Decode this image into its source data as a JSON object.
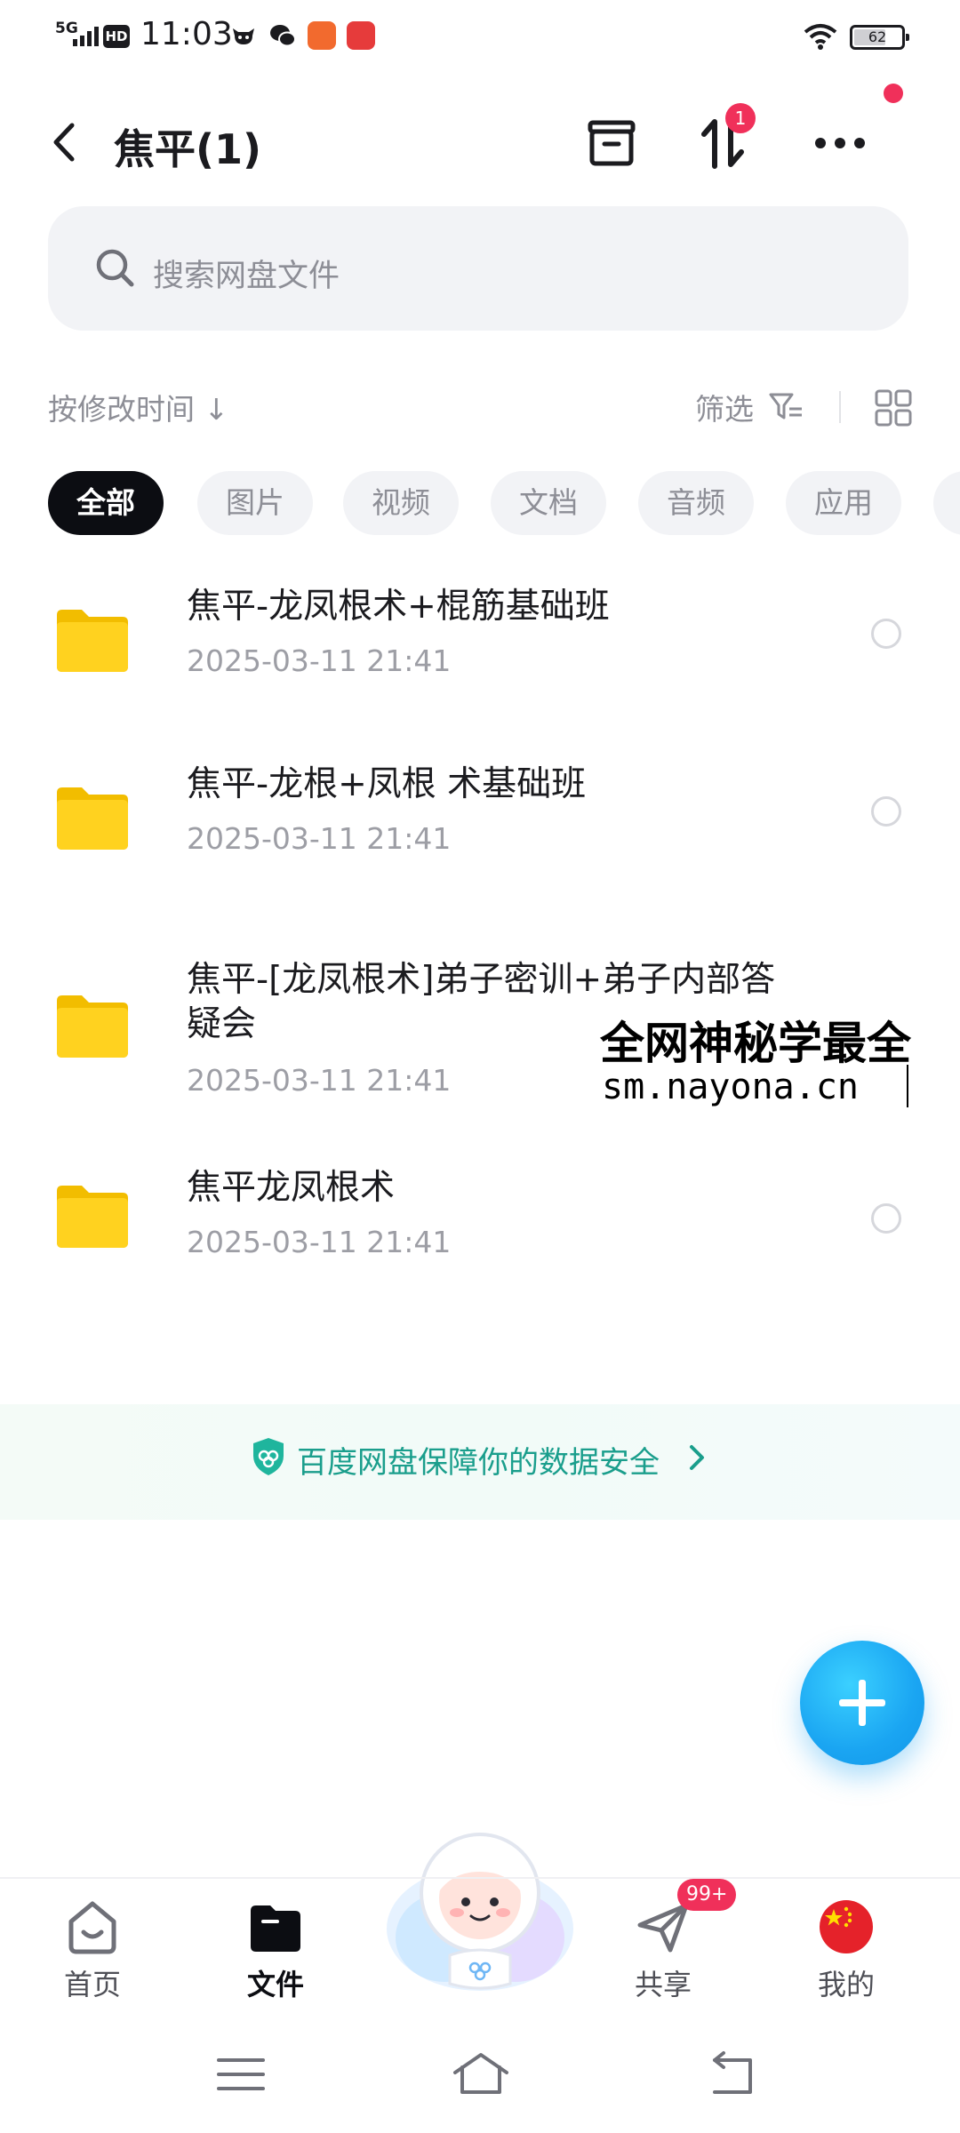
{
  "status_bar": {
    "network": "5G",
    "hd": "HD",
    "time": "11:03",
    "battery": "62"
  },
  "header": {
    "title": "焦平(1)",
    "transfer_badge": "1"
  },
  "search": {
    "placeholder": "搜索网盘文件"
  },
  "sort": {
    "label": "按修改时间 ↓",
    "filter_label": "筛选"
  },
  "chips": [
    {
      "label": "全部",
      "active": true
    },
    {
      "label": "图片",
      "active": false
    },
    {
      "label": "视频",
      "active": false
    },
    {
      "label": "文档",
      "active": false
    },
    {
      "label": "音频",
      "active": false
    },
    {
      "label": "应用",
      "active": false
    }
  ],
  "files": [
    {
      "name": "焦平-龙凤根术+棍筋基础班",
      "date": "2025-03-11  21:41"
    },
    {
      "name": "焦平-龙根+凤根 术基础班",
      "date": "2025-03-11  21:41"
    },
    {
      "name": "焦平-[龙凤根术]弟子密训+弟子内部答疑会",
      "date": "2025-03-11  21:41"
    },
    {
      "name": "焦平龙凤根术",
      "date": "2025-03-11  21:41"
    }
  ],
  "watermark": {
    "title": "全网神秘学最全",
    "url": "sm.nayona.cn"
  },
  "security_banner": {
    "text": "百度网盘保障你的数据安全"
  },
  "bottom_nav": {
    "items": [
      {
        "label": "首页",
        "icon": "home-icon"
      },
      {
        "label": "文件",
        "icon": "folder-icon",
        "active": true
      },
      {
        "label": "共享",
        "icon": "send-icon",
        "badge": "99+"
      },
      {
        "label": "我的",
        "icon": "avatar-flag-icon"
      }
    ]
  },
  "colors": {
    "accent": "#1aa5f2",
    "badge": "#f0305a",
    "folder": "#ffcf0f",
    "security_text": "#1a9e8c"
  }
}
